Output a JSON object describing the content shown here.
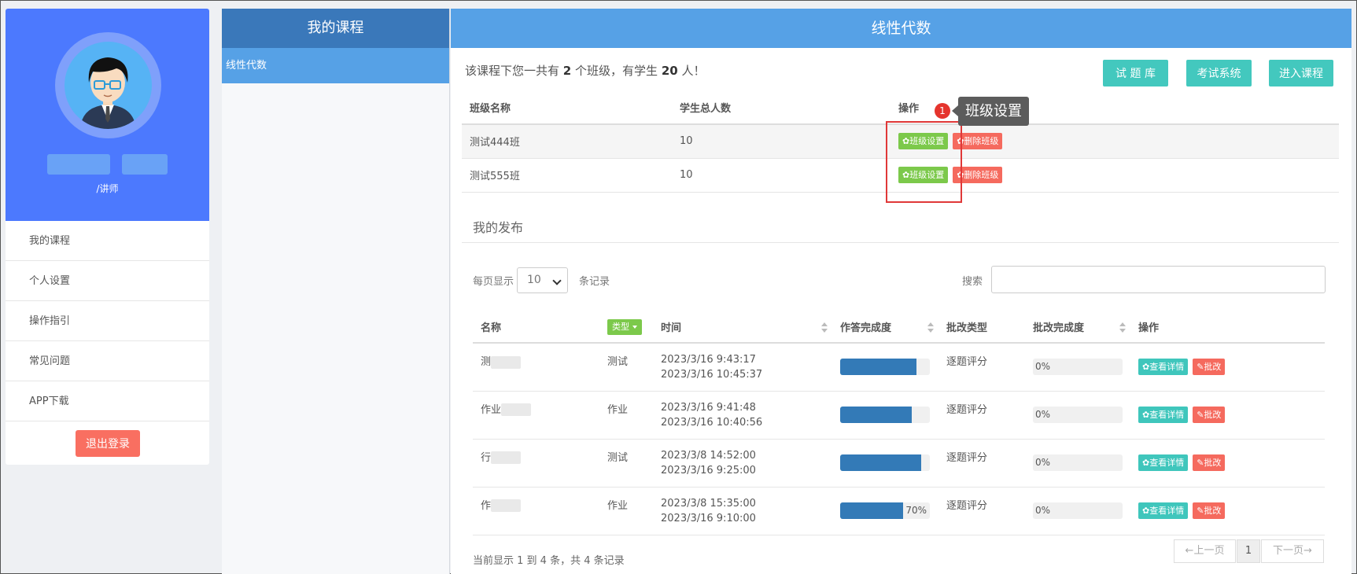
{
  "sidebar": {
    "role": "/讲师",
    "menu": [
      "我的课程",
      "个人设置",
      "操作指引",
      "常见问题",
      "APP下载"
    ],
    "logout": "退出登录"
  },
  "courses": {
    "title": "我的课程",
    "items": [
      "线性代数"
    ]
  },
  "main": {
    "title": "线性代数",
    "summary_prefix": "该课程下您一共有",
    "class_count": "2",
    "summary_mid": "个班级，有学生",
    "student_count": "20",
    "summary_suffix": "人！",
    "buttons": {
      "question_bank": "试 题 库",
      "exam_system": "考试系统",
      "enter_course": "进入课程"
    }
  },
  "class_table": {
    "headers": [
      "班级名称",
      "学生总人数",
      "操作"
    ],
    "rows": [
      {
        "name": "测试444班",
        "students": "10"
      },
      {
        "name": "测试555班",
        "students": "10"
      }
    ],
    "settings_btn": "✿班级设置",
    "delete_btn": "✿删除班级"
  },
  "annotation": {
    "badge": "1",
    "tooltip": "班级设置"
  },
  "publish": {
    "title": "我的发布",
    "per_page_label": "每页显示",
    "per_page_value": "10",
    "records_label": "条记录",
    "search_label": "搜索",
    "headers": {
      "name": "名称",
      "type": "类型",
      "time": "时间",
      "completion": "作答完成度",
      "grade_type": "批改类型",
      "grade_progress": "批改完成度",
      "ops": "操作"
    },
    "rows": [
      {
        "name": "测",
        "type": "测试",
        "time1": "2023/3/16 9:43:17",
        "time2": "2023/3/16 10:45:37",
        "completion": 0.85,
        "completion_label": "",
        "grade_type": "逐题评分",
        "grade_progress": "0%"
      },
      {
        "name": "作业",
        "type": "作业",
        "time1": "2023/3/16 9:41:48",
        "time2": "2023/3/16 10:40:56",
        "completion": 0.8,
        "completion_label": "",
        "grade_type": "逐题评分",
        "grade_progress": "0%"
      },
      {
        "name": "行",
        "type": "测试",
        "time1": "2023/3/8 14:52:00",
        "time2": "2023/3/16 9:25:00",
        "completion": 0.9,
        "completion_label": "",
        "grade_type": "逐题评分",
        "grade_progress": "0%"
      },
      {
        "name": "作",
        "type": "作业",
        "time1": "2023/3/8 15:35:00",
        "time2": "2023/3/16 9:10:00",
        "completion": 0.7,
        "completion_label": "70%",
        "grade_type": "逐题评分",
        "grade_progress": "0%"
      }
    ],
    "view_btn": "✿查看详情",
    "grade_btn": "✎批改",
    "info": "当前显示 1 到 4 条，共 4 条记录",
    "prev": "←上一页",
    "page": "1",
    "next": "下一页→"
  }
}
